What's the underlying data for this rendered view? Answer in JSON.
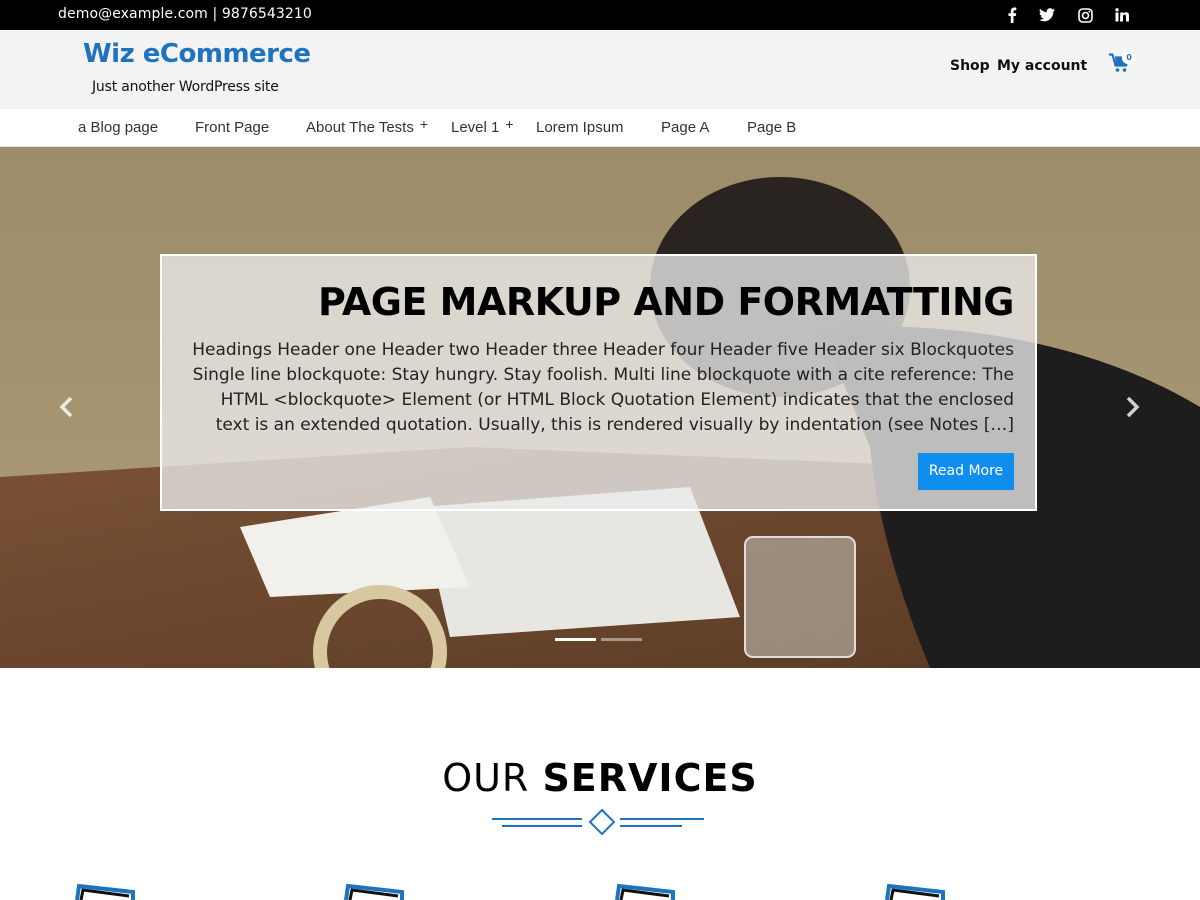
{
  "topbar": {
    "contact": "demo@example.com | 9876543210",
    "social": [
      "facebook-icon",
      "twitter-icon",
      "instagram-icon",
      "linkedin-icon"
    ]
  },
  "header": {
    "site_title": "Wiz eCommerce",
    "site_description": "Just another WordPress site",
    "shop_label": "Shop",
    "account_label": "My account",
    "cart_count": "0"
  },
  "nav": {
    "items": [
      {
        "label": "a Blog page",
        "has_children": false
      },
      {
        "label": "Front Page",
        "has_children": false
      },
      {
        "label": "About The Tests",
        "has_children": true
      },
      {
        "label": "Level 1",
        "has_children": true
      },
      {
        "label": "Lorem Ipsum",
        "has_children": false
      },
      {
        "label": "Page A",
        "has_children": false
      },
      {
        "label": "Page B",
        "has_children": false
      }
    ],
    "plus": "+"
  },
  "slider": {
    "title": "PAGE MARKUP AND FORMATTING",
    "excerpt": "Headings Header one Header two Header three Header four Header five Header six Blockquotes Single line blockquote: Stay hungry. Stay foolish. Multi line blockquote with a cite reference: The HTML <blockquote> Element (or HTML Block Quotation Element) indicates that the enclosed text is an extended quotation. Usually, this is rendered visually by indentation (see Notes […]",
    "button_label": "Read More",
    "active_slide": 1,
    "slide_count": 2
  },
  "services": {
    "title_light": "OUR",
    "title_bold": "SERVICES"
  },
  "colors": {
    "accent": "#1e73be",
    "button": "#0f8ef0",
    "topbar": "#000000",
    "header_bg": "#f3f3f3"
  }
}
